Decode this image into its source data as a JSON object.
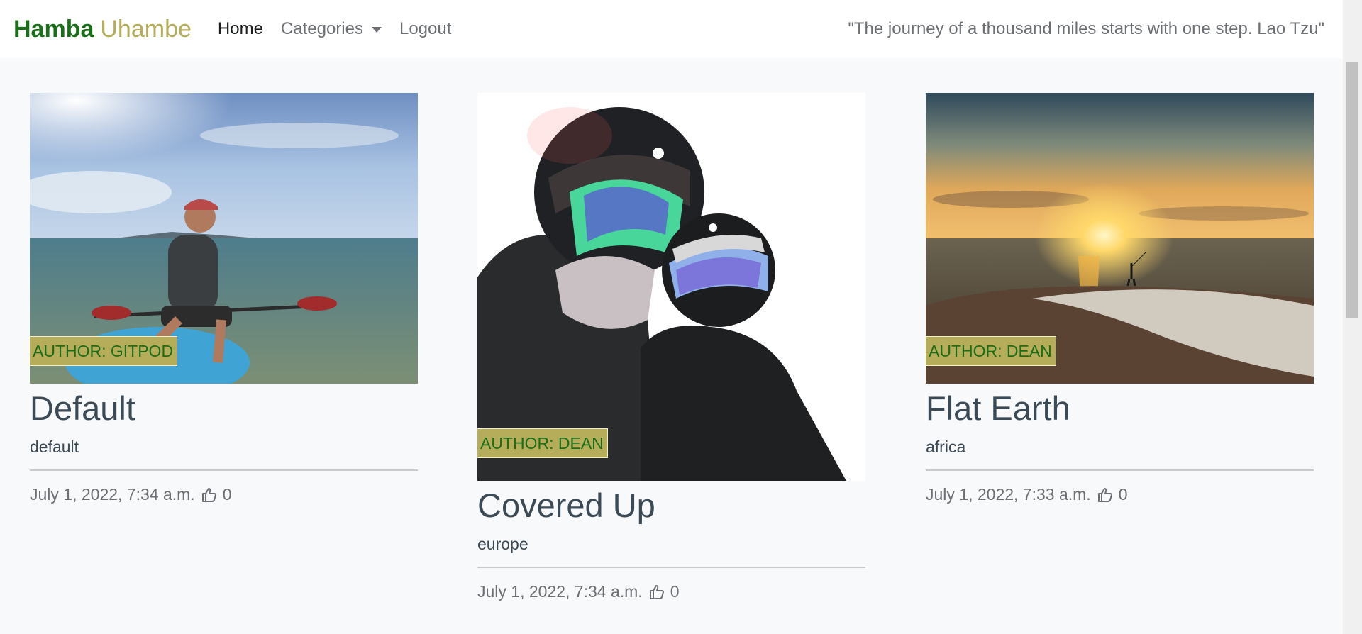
{
  "navbar": {
    "brand_primary": "Hamba",
    "brand_secondary": "Uhambe",
    "links": [
      {
        "label": "Home"
      },
      {
        "label": "Categories"
      },
      {
        "label": "Logout"
      }
    ],
    "quote": "\"The journey of a thousand miles starts with one step. Lao Tzu\""
  },
  "posts": [
    {
      "title": "Default",
      "author": "AUTHOR: GITPOD",
      "excerpt": "default",
      "date": "July 1, 2022, 7:34 a.m.",
      "likes": "0",
      "image_alt": "kayaking"
    },
    {
      "title": "Covered Up",
      "author": "AUTHOR: DEAN",
      "excerpt": "europe",
      "date": "July 1, 2022, 7:34 a.m.",
      "likes": "0",
      "image_alt": "ski selfie"
    },
    {
      "title": "Flat Earth",
      "author": "AUTHOR: DEAN",
      "excerpt": "africa",
      "date": "July 1, 2022, 7:33 a.m.",
      "likes": "0",
      "image_alt": "sunset beach"
    }
  ],
  "colors": {
    "brand_green": "#1a6e1a",
    "brand_olive": "#b5ad5a",
    "page_bg": "#f7f9fa"
  }
}
